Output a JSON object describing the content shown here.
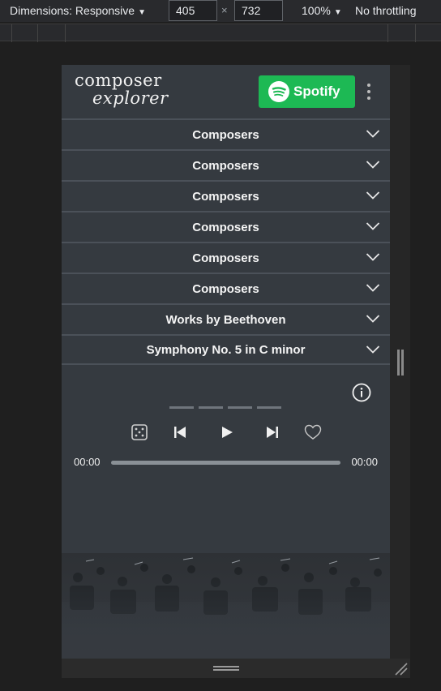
{
  "devtools": {
    "dimensions_label": "Dimensions: Responsive",
    "width_value": "405",
    "height_value": "732",
    "times_symbol": "×",
    "zoom_label": "100%",
    "throttle_label": "No throttling"
  },
  "app": {
    "logo_line1": "composer",
    "logo_line2": "explorer",
    "spotify_label": "Spotify",
    "accordion_rows": [
      {
        "label": "Composers"
      },
      {
        "label": "Composers"
      },
      {
        "label": "Composers"
      },
      {
        "label": "Composers"
      },
      {
        "label": "Composers"
      },
      {
        "label": "Composers"
      },
      {
        "label": "Works by Beethoven"
      },
      {
        "label": "Symphony No. 5 in C minor"
      }
    ],
    "player": {
      "time_elapsed": "00:00",
      "time_total": "00:00",
      "progress": 0
    }
  },
  "colors": {
    "spotify_green": "#1db954",
    "app_background": "#353a40",
    "row_divider": "#4b5159"
  }
}
